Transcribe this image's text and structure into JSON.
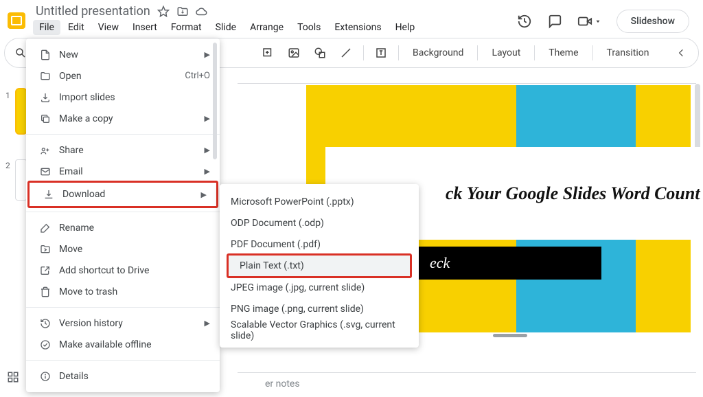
{
  "doc": {
    "title": "Untitled presentation"
  },
  "menus": {
    "file": "File",
    "edit": "Edit",
    "view": "View",
    "insert": "Insert",
    "format": "Format",
    "slide": "Slide",
    "arrange": "Arrange",
    "tools": "Tools",
    "extensions": "Extensions",
    "help": "Help"
  },
  "header_buttons": {
    "slideshow": "Slideshow"
  },
  "toolbar": {
    "background": "Background",
    "layout": "Layout",
    "theme": "Theme",
    "transition": "Transition"
  },
  "file_menu": {
    "new": "New",
    "open": "Open",
    "open_hint": "Ctrl+O",
    "import_slides": "Import slides",
    "make_copy": "Make a copy",
    "share": "Share",
    "email": "Email",
    "download": "Download",
    "rename": "Rename",
    "move": "Move",
    "add_shortcut": "Add shortcut to Drive",
    "move_to_trash": "Move to trash",
    "version_history": "Version history",
    "available_offline": "Make available offline",
    "details": "Details"
  },
  "download_menu": {
    "pptx": "Microsoft PowerPoint (.pptx)",
    "odp": "ODP Document (.odp)",
    "pdf": "PDF Document (.pdf)",
    "txt": "Plain Text (.txt)",
    "jpg": "JPEG image (.jpg, current slide)",
    "png": "PNG image (.png, current slide)",
    "svg": "Scalable Vector Graphics (.svg, current slide)"
  },
  "filmstrip": {
    "n1": "1",
    "n2": "2"
  },
  "slide_content": {
    "title": "ck Your Google Slides Word Count",
    "sub": "eck"
  },
  "notes": {
    "placeholder": "er notes"
  }
}
